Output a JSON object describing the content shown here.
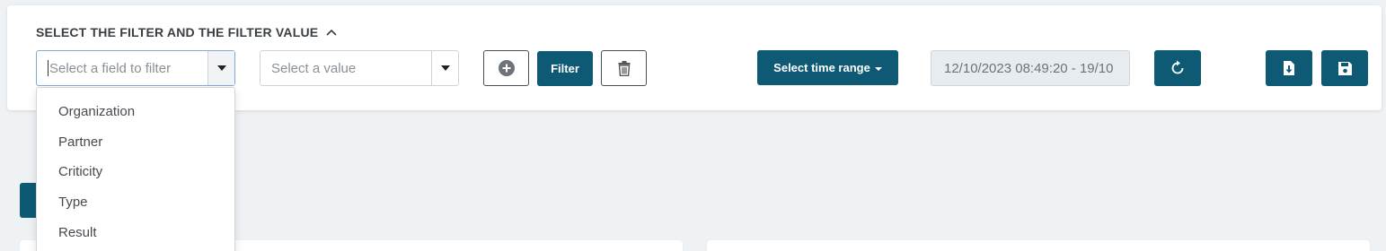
{
  "filter_panel": {
    "heading": "SELECT THE FILTER AND THE FILTER VALUE",
    "heading_icon": "chevron-up-icon",
    "field_select": {
      "placeholder": "Select a field to filter",
      "options": [
        "Organization",
        "Partner",
        "Criticity",
        "Type",
        "Result"
      ]
    },
    "value_select": {
      "placeholder": "Select a value"
    },
    "add_icon": "plus-circle-icon",
    "filter_label": "Filter",
    "trash_icon": "trash-icon",
    "time_range_label": "Select time range",
    "date_range_value": "12/10/2023 08:49:20 - 19/10",
    "refresh_icon": "refresh-icon",
    "download_icon": "download-icon",
    "save_icon": "save-icon"
  },
  "colors": {
    "accent": "#0e5a74",
    "background": "#eff2f5",
    "panel": "#ffffff"
  }
}
